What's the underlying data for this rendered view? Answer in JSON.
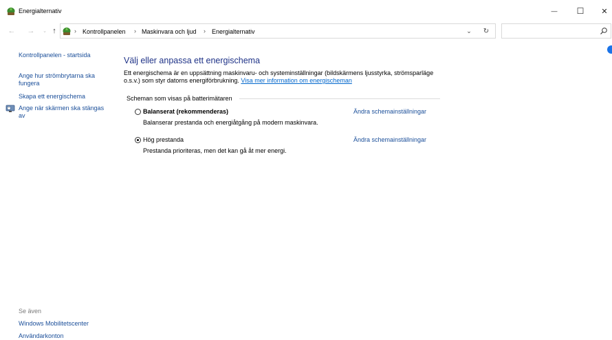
{
  "window": {
    "title": "Energialternativ",
    "minimize_glyph": "—",
    "maximize_glyph": "☐",
    "close_glyph": "✕"
  },
  "address_bar": {
    "breadcrumbs": [
      "Kontrollpanelen",
      "Maskinvara och ljud",
      "Energialternativ"
    ],
    "separator": "›",
    "search_placeholder": ""
  },
  "sidebar": {
    "items": [
      {
        "label": "Kontrollpanelen - startsida"
      },
      {
        "label": "Ange hur strömbrytarna ska fungera"
      },
      {
        "label": "Skapa ett energischema"
      },
      {
        "label": "Ange när skärmen ska stängas av",
        "icon": "monitor-clock-icon"
      }
    ],
    "see_also_label": "Se även",
    "see_also": [
      {
        "label": "Windows Mobilitetscenter"
      },
      {
        "label": "Användarkonton"
      }
    ]
  },
  "main": {
    "title": "Välj eller anpassa ett energischema",
    "description": "Ett energischema är en uppsättning maskinvaru- och systeminställningar (bildskärmens ljusstyrka, strömsparläge o.s.v.) som styr datorns energiförbrukning.",
    "description_link": "Visa mer information om energischeman",
    "group_label": "Scheman som visas på batterimätaren",
    "plans": [
      {
        "name": "Balanserat (rekommenderas)",
        "description": "Balanserar prestanda och energiåtgång på modern maskinvara.",
        "link": "Ändra schemainställningar",
        "selected": false
      },
      {
        "name": "Hög prestanda",
        "description": "Prestanda prioriteras, men det kan gå åt mer energi.",
        "link": "Ändra schemainställningar",
        "selected": true
      }
    ]
  },
  "colors": {
    "link": "#1a4e99",
    "title": "#1e3287",
    "inline_link": "#0066cc"
  }
}
